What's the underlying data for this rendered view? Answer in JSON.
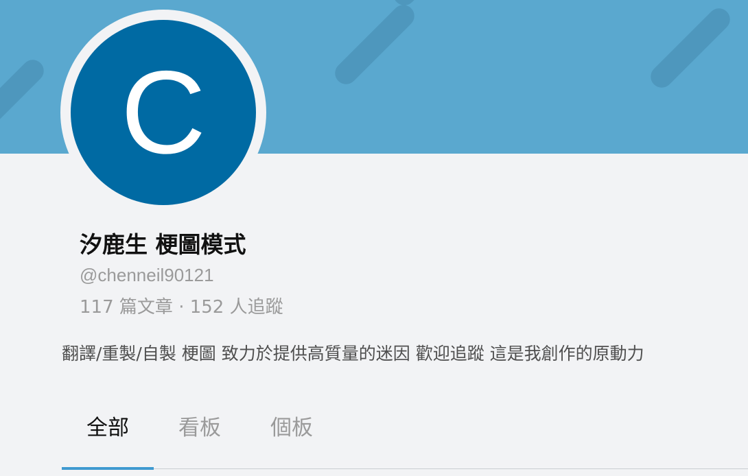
{
  "profile": {
    "avatar_letter": "C",
    "name": "汐鹿生 梗圖模式",
    "handle": "@chenneil90121",
    "stats": {
      "posts_count": "117",
      "posts_label": "篇文章",
      "separator": "·",
      "followers_count": "152",
      "followers_label": "人追蹤"
    },
    "bio": "翻譯/重製/自製 梗圖 致力於提供高質量的迷因 歡迎追蹤 這是我創作的原動力"
  },
  "tabs": [
    {
      "label": "全部",
      "active": true
    },
    {
      "label": "看板",
      "active": false
    },
    {
      "label": "個板",
      "active": false
    }
  ],
  "colors": {
    "cover": "#5aa8cf",
    "avatar": "#006aa3",
    "accent": "#3f9ad0"
  }
}
